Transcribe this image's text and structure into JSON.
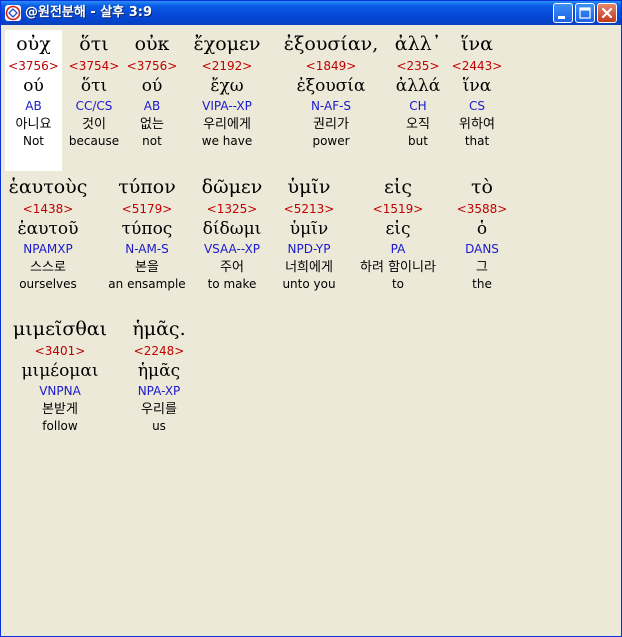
{
  "window": {
    "title": "@원전분해 - 살후 3:9"
  },
  "words": [
    {
      "greek": "οὐχ",
      "strong": "<3756>",
      "lemma": "ού",
      "parse": "AB",
      "korean": "아니요",
      "english": "Not"
    },
    {
      "greek": "ὅτι",
      "strong": "<3754>",
      "lemma": "ὅτι",
      "parse": "CC/CS",
      "korean": "것이",
      "english": "because"
    },
    {
      "greek": "οὐκ",
      "strong": "<3756>",
      "lemma": "ού",
      "parse": "AB",
      "korean": "없는",
      "english": "not"
    },
    {
      "greek": "ἔχομεν",
      "strong": "<2192>",
      "lemma": "ἔχω",
      "parse": "VIPA--XP",
      "korean": "우리에게",
      "english": "we have"
    },
    {
      "greek": "ἐξουσίαν,",
      "strong": "<1849>",
      "lemma": "ἐξουσία",
      "parse": "N-AF-S",
      "korean": "권리가",
      "english": "power"
    },
    {
      "greek": "ἀλλ᾽",
      "strong": "<235>",
      "lemma": "ἀλλά",
      "parse": "CH",
      "korean": "오직",
      "english": "but"
    },
    {
      "greek": "ἵνα",
      "strong": "<2443>",
      "lemma": "ἵνα",
      "parse": "CS",
      "korean": "위하여",
      "english": "that"
    },
    {
      "greek": "ἑαυτοὺς",
      "strong": "<1438>",
      "lemma": "ἑαυτοῦ",
      "parse": "NPAMXP",
      "korean": "스스로",
      "english": "ourselves"
    },
    {
      "greek": "τύπον",
      "strong": "<5179>",
      "lemma": "τύπος",
      "parse": "N-AM-S",
      "korean": "본을",
      "english": "an ensample"
    },
    {
      "greek": "δῶμεν",
      "strong": "<1325>",
      "lemma": "δίδωμι",
      "parse": "VSAA--XP",
      "korean": "주어",
      "english": "to make"
    },
    {
      "greek": "ὑμῖν",
      "strong": "<5213>",
      "lemma": "ὑμῖν",
      "parse": "NPD-YP",
      "korean": "너희에게",
      "english": "unto you"
    },
    {
      "greek": "εἰς",
      "strong": "<1519>",
      "lemma": "εἰς",
      "parse": "PA",
      "korean": "하려 함이니라",
      "english": "to"
    },
    {
      "greek": "τὸ",
      "strong": "<3588>",
      "lemma": "ὁ",
      "parse": "DANS",
      "korean": "그",
      "english": "the"
    },
    {
      "greek": "μιμεῖσθαι",
      "strong": "<3401>",
      "lemma": "μιμέομαι",
      "parse": "VNPNA",
      "korean": "본받게",
      "english": "follow"
    },
    {
      "greek": "ἡμᾶς.",
      "strong": "<2248>",
      "lemma": "ἡμᾶς",
      "parse": "NPA-XP",
      "korean": "우리를",
      "english": "us"
    }
  ]
}
